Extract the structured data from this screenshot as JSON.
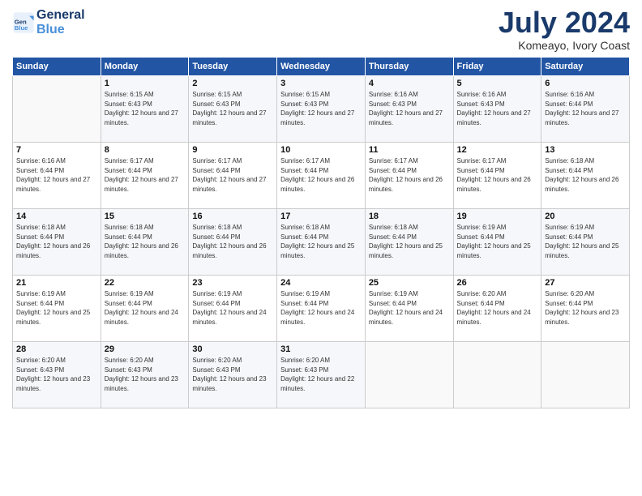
{
  "header": {
    "logo_line1": "General",
    "logo_line2": "Blue",
    "month": "July 2024",
    "location": "Komeayo, Ivory Coast"
  },
  "days_of_week": [
    "Sunday",
    "Monday",
    "Tuesday",
    "Wednesday",
    "Thursday",
    "Friday",
    "Saturday"
  ],
  "weeks": [
    [
      {
        "day": "",
        "sunrise": "",
        "sunset": "",
        "daylight": ""
      },
      {
        "day": "1",
        "sunrise": "Sunrise: 6:15 AM",
        "sunset": "Sunset: 6:43 PM",
        "daylight": "Daylight: 12 hours and 27 minutes."
      },
      {
        "day": "2",
        "sunrise": "Sunrise: 6:15 AM",
        "sunset": "Sunset: 6:43 PM",
        "daylight": "Daylight: 12 hours and 27 minutes."
      },
      {
        "day": "3",
        "sunrise": "Sunrise: 6:15 AM",
        "sunset": "Sunset: 6:43 PM",
        "daylight": "Daylight: 12 hours and 27 minutes."
      },
      {
        "day": "4",
        "sunrise": "Sunrise: 6:16 AM",
        "sunset": "Sunset: 6:43 PM",
        "daylight": "Daylight: 12 hours and 27 minutes."
      },
      {
        "day": "5",
        "sunrise": "Sunrise: 6:16 AM",
        "sunset": "Sunset: 6:43 PM",
        "daylight": "Daylight: 12 hours and 27 minutes."
      },
      {
        "day": "6",
        "sunrise": "Sunrise: 6:16 AM",
        "sunset": "Sunset: 6:44 PM",
        "daylight": "Daylight: 12 hours and 27 minutes."
      }
    ],
    [
      {
        "day": "7",
        "sunrise": "Sunrise: 6:16 AM",
        "sunset": "Sunset: 6:44 PM",
        "daylight": "Daylight: 12 hours and 27 minutes."
      },
      {
        "day": "8",
        "sunrise": "Sunrise: 6:17 AM",
        "sunset": "Sunset: 6:44 PM",
        "daylight": "Daylight: 12 hours and 27 minutes."
      },
      {
        "day": "9",
        "sunrise": "Sunrise: 6:17 AM",
        "sunset": "Sunset: 6:44 PM",
        "daylight": "Daylight: 12 hours and 27 minutes."
      },
      {
        "day": "10",
        "sunrise": "Sunrise: 6:17 AM",
        "sunset": "Sunset: 6:44 PM",
        "daylight": "Daylight: 12 hours and 26 minutes."
      },
      {
        "day": "11",
        "sunrise": "Sunrise: 6:17 AM",
        "sunset": "Sunset: 6:44 PM",
        "daylight": "Daylight: 12 hours and 26 minutes."
      },
      {
        "day": "12",
        "sunrise": "Sunrise: 6:17 AM",
        "sunset": "Sunset: 6:44 PM",
        "daylight": "Daylight: 12 hours and 26 minutes."
      },
      {
        "day": "13",
        "sunrise": "Sunrise: 6:18 AM",
        "sunset": "Sunset: 6:44 PM",
        "daylight": "Daylight: 12 hours and 26 minutes."
      }
    ],
    [
      {
        "day": "14",
        "sunrise": "Sunrise: 6:18 AM",
        "sunset": "Sunset: 6:44 PM",
        "daylight": "Daylight: 12 hours and 26 minutes."
      },
      {
        "day": "15",
        "sunrise": "Sunrise: 6:18 AM",
        "sunset": "Sunset: 6:44 PM",
        "daylight": "Daylight: 12 hours and 26 minutes."
      },
      {
        "day": "16",
        "sunrise": "Sunrise: 6:18 AM",
        "sunset": "Sunset: 6:44 PM",
        "daylight": "Daylight: 12 hours and 26 minutes."
      },
      {
        "day": "17",
        "sunrise": "Sunrise: 6:18 AM",
        "sunset": "Sunset: 6:44 PM",
        "daylight": "Daylight: 12 hours and 25 minutes."
      },
      {
        "day": "18",
        "sunrise": "Sunrise: 6:18 AM",
        "sunset": "Sunset: 6:44 PM",
        "daylight": "Daylight: 12 hours and 25 minutes."
      },
      {
        "day": "19",
        "sunrise": "Sunrise: 6:19 AM",
        "sunset": "Sunset: 6:44 PM",
        "daylight": "Daylight: 12 hours and 25 minutes."
      },
      {
        "day": "20",
        "sunrise": "Sunrise: 6:19 AM",
        "sunset": "Sunset: 6:44 PM",
        "daylight": "Daylight: 12 hours and 25 minutes."
      }
    ],
    [
      {
        "day": "21",
        "sunrise": "Sunrise: 6:19 AM",
        "sunset": "Sunset: 6:44 PM",
        "daylight": "Daylight: 12 hours and 25 minutes."
      },
      {
        "day": "22",
        "sunrise": "Sunrise: 6:19 AM",
        "sunset": "Sunset: 6:44 PM",
        "daylight": "Daylight: 12 hours and 24 minutes."
      },
      {
        "day": "23",
        "sunrise": "Sunrise: 6:19 AM",
        "sunset": "Sunset: 6:44 PM",
        "daylight": "Daylight: 12 hours and 24 minutes."
      },
      {
        "day": "24",
        "sunrise": "Sunrise: 6:19 AM",
        "sunset": "Sunset: 6:44 PM",
        "daylight": "Daylight: 12 hours and 24 minutes."
      },
      {
        "day": "25",
        "sunrise": "Sunrise: 6:19 AM",
        "sunset": "Sunset: 6:44 PM",
        "daylight": "Daylight: 12 hours and 24 minutes."
      },
      {
        "day": "26",
        "sunrise": "Sunrise: 6:20 AM",
        "sunset": "Sunset: 6:44 PM",
        "daylight": "Daylight: 12 hours and 24 minutes."
      },
      {
        "day": "27",
        "sunrise": "Sunrise: 6:20 AM",
        "sunset": "Sunset: 6:44 PM",
        "daylight": "Daylight: 12 hours and 23 minutes."
      }
    ],
    [
      {
        "day": "28",
        "sunrise": "Sunrise: 6:20 AM",
        "sunset": "Sunset: 6:43 PM",
        "daylight": "Daylight: 12 hours and 23 minutes."
      },
      {
        "day": "29",
        "sunrise": "Sunrise: 6:20 AM",
        "sunset": "Sunset: 6:43 PM",
        "daylight": "Daylight: 12 hours and 23 minutes."
      },
      {
        "day": "30",
        "sunrise": "Sunrise: 6:20 AM",
        "sunset": "Sunset: 6:43 PM",
        "daylight": "Daylight: 12 hours and 23 minutes."
      },
      {
        "day": "31",
        "sunrise": "Sunrise: 6:20 AM",
        "sunset": "Sunset: 6:43 PM",
        "daylight": "Daylight: 12 hours and 22 minutes."
      },
      {
        "day": "",
        "sunrise": "",
        "sunset": "",
        "daylight": ""
      },
      {
        "day": "",
        "sunrise": "",
        "sunset": "",
        "daylight": ""
      },
      {
        "day": "",
        "sunrise": "",
        "sunset": "",
        "daylight": ""
      }
    ]
  ]
}
